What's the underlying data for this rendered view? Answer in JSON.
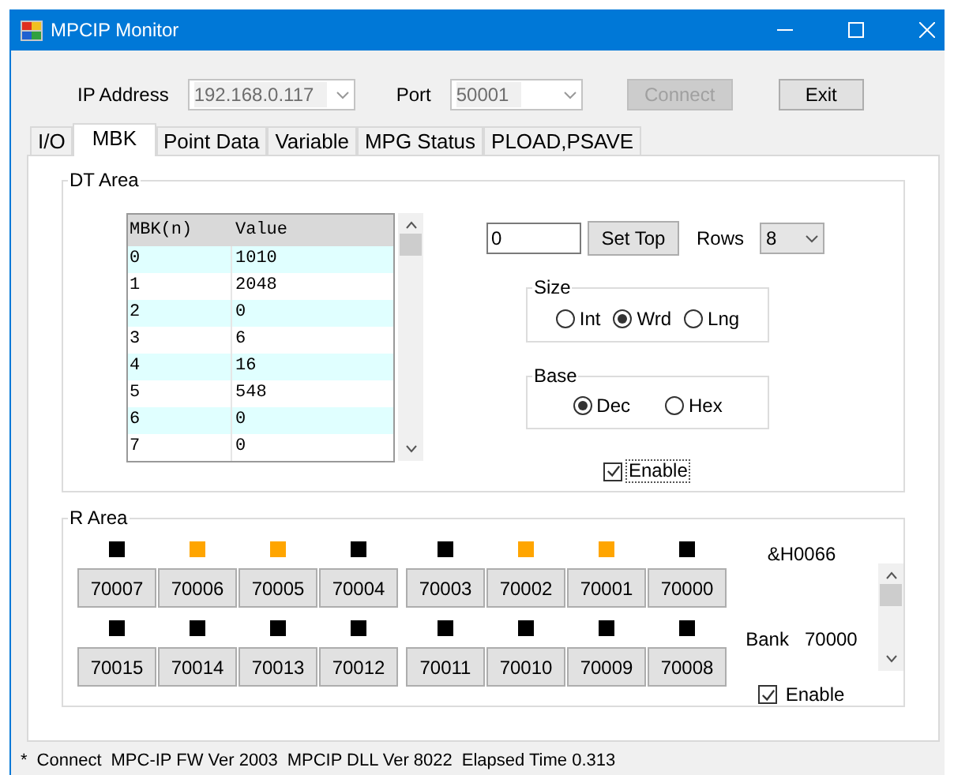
{
  "window": {
    "title": "MPCIP Monitor"
  },
  "connection": {
    "ip_label": "IP Address",
    "ip_value": "192.168.0.117",
    "port_label": "Port",
    "port_value": "50001",
    "connect_button": {
      "label": "Connect",
      "disabled": true
    },
    "exit_button": {
      "label": "Exit",
      "disabled": false
    }
  },
  "tabs": [
    {
      "label": "I/O",
      "selected": false
    },
    {
      "label": "MBK",
      "selected": true
    },
    {
      "label": "Point Data",
      "selected": false
    },
    {
      "label": "Variable",
      "selected": false
    },
    {
      "label": "MPG Status",
      "selected": false
    },
    {
      "label": "PLOAD,PSAVE",
      "selected": false
    }
  ],
  "dt_area": {
    "title": "DT Area",
    "columns": [
      "MBK(n)",
      "Value"
    ],
    "rows": [
      [
        "0",
        "1010"
      ],
      [
        "1",
        "2048"
      ],
      [
        "2",
        "0"
      ],
      [
        "3",
        "6"
      ],
      [
        "4",
        "16"
      ],
      [
        "5",
        "548"
      ],
      [
        "6",
        "0"
      ],
      [
        "7",
        "0"
      ]
    ],
    "top_field": "0",
    "set_top_button": "Set Top",
    "rows_label": "Rows",
    "rows_value": "8",
    "size": {
      "title": "Size",
      "options": [
        {
          "label": "Int",
          "selected": false
        },
        {
          "label": "Wrd",
          "selected": true
        },
        {
          "label": "Lng",
          "selected": false
        }
      ]
    },
    "base": {
      "title": "Base",
      "options": [
        {
          "label": "Dec",
          "selected": true
        },
        {
          "label": "Hex",
          "selected": false
        }
      ]
    },
    "enable": {
      "label": "Enable",
      "checked": true
    }
  },
  "r_area": {
    "title": "R Area",
    "rows": [
      {
        "bits": [
          {
            "label": "70007",
            "on": false
          },
          {
            "label": "70006",
            "on": true
          },
          {
            "label": "70005",
            "on": true
          },
          {
            "label": "70004",
            "on": false
          },
          {
            "label": "70003",
            "on": false
          },
          {
            "label": "70002",
            "on": true
          },
          {
            "label": "70001",
            "on": true
          },
          {
            "label": "70000",
            "on": false
          }
        ]
      },
      {
        "bits": [
          {
            "label": "70015",
            "on": false
          },
          {
            "label": "70014",
            "on": false
          },
          {
            "label": "70013",
            "on": false
          },
          {
            "label": "70012",
            "on": false
          },
          {
            "label": "70011",
            "on": false
          },
          {
            "label": "70010",
            "on": false
          },
          {
            "label": "70009",
            "on": false
          },
          {
            "label": "70008",
            "on": false
          }
        ]
      }
    ],
    "hex_value": "&H0066",
    "bank_label": "Bank",
    "bank_value": "70000",
    "enable": {
      "label": "Enable",
      "checked": true
    }
  },
  "status_bar": {
    "items": [
      "*",
      "Connect",
      "MPC-IP FW Ver 2003",
      "MPCIP DLL Ver 8022",
      "Elapsed Time 0.313"
    ]
  }
}
